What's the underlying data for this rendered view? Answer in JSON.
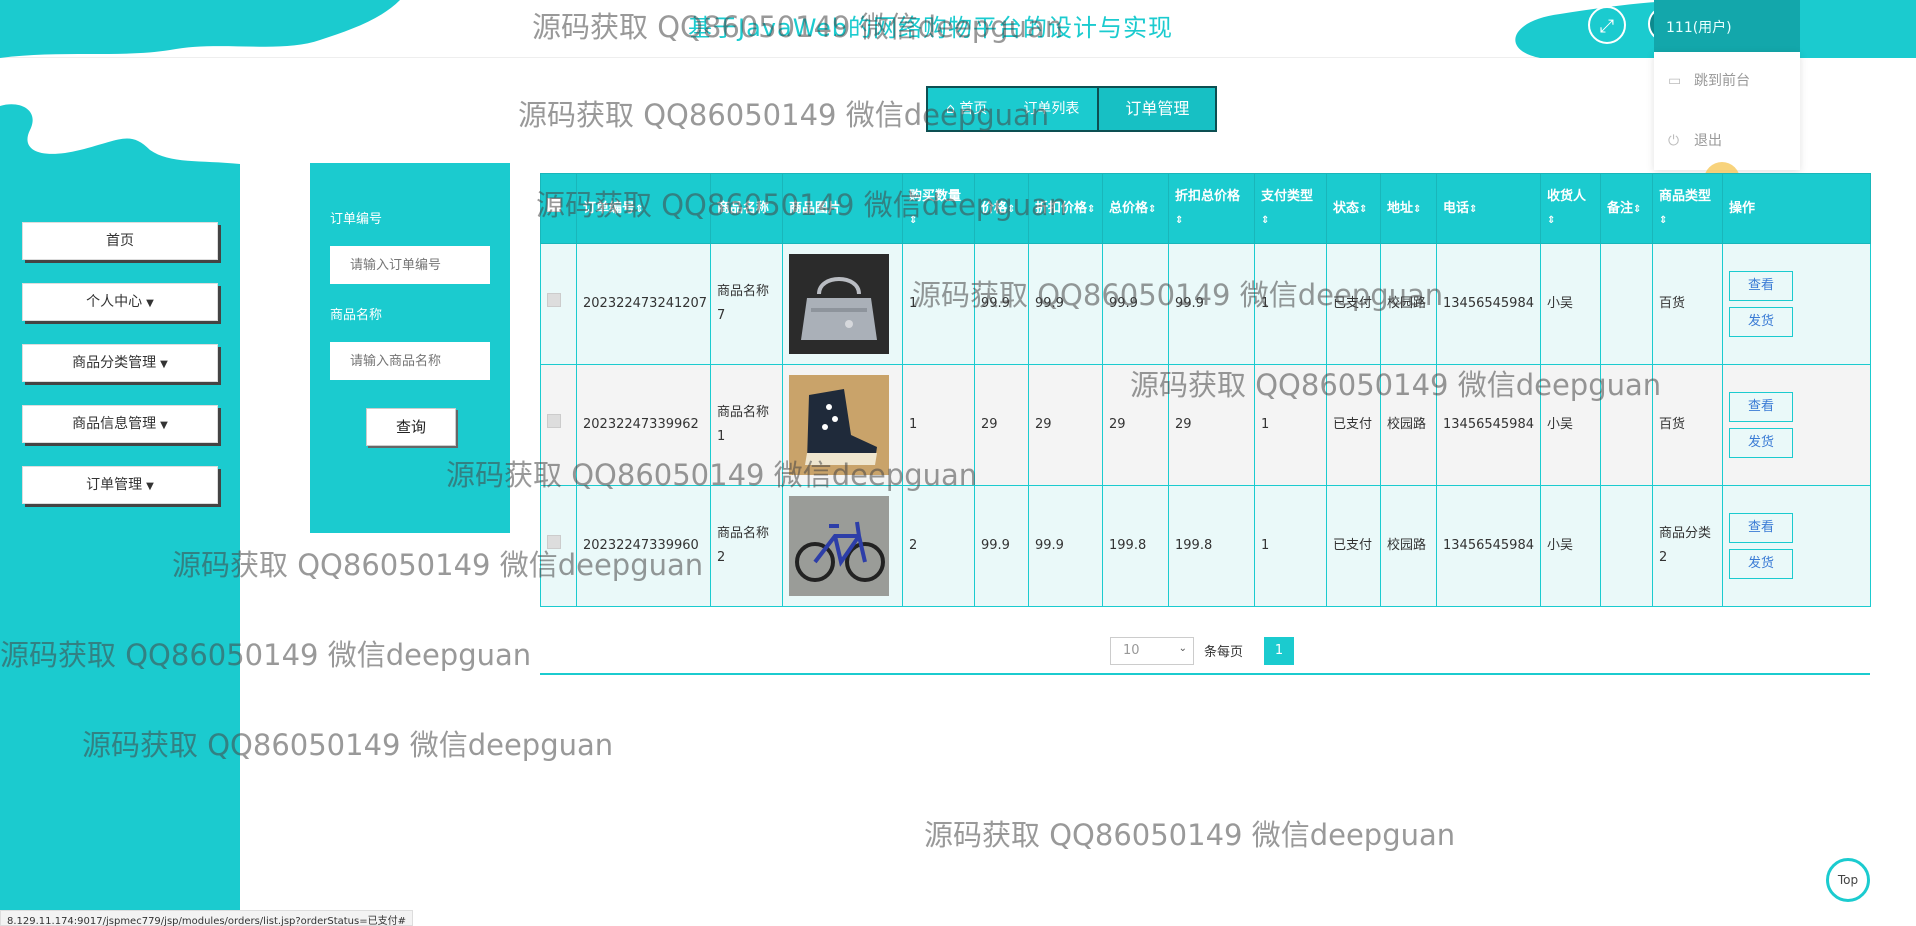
{
  "header": {
    "site_title": "基于JavaWeb的网络购物平台的设计与实现",
    "user_name": "111(用户)",
    "menu": [
      {
        "label": "跳到前台"
      },
      {
        "label": "退出"
      }
    ]
  },
  "breadcrumb": [
    "首页",
    "订单管理",
    "订单列表",
    "订单管理"
  ],
  "sidebar": {
    "items": [
      {
        "label": "首页"
      },
      {
        "label": "个人中心"
      },
      {
        "label": "商品分类管理"
      },
      {
        "label": "商品信息管理"
      },
      {
        "label": "订单管理"
      }
    ]
  },
  "search": {
    "order_no_label": "订单编号",
    "order_no_placeholder": "请输入订单编号",
    "product_name_label": "商品名称",
    "product_name_placeholder": "请输入商品名称",
    "query_button": "查询"
  },
  "table": {
    "headers": [
      "订单编号",
      "商品名称",
      "商品图片",
      "购买数量",
      "价格",
      "折扣价格",
      "总价格",
      "折扣总价格",
      "支付类型",
      "状态",
      "地址",
      "电话",
      "收货人",
      "备注",
      "商品类型",
      "操作"
    ],
    "rows": [
      {
        "order_no": "202322473241207",
        "name": "商品名称7",
        "image": "handbag",
        "qty": "1",
        "price": "99.9",
        "discount_price": "99.9",
        "total": "99.9",
        "discount_total": "99.9",
        "pay_type": "1",
        "status": "已支付",
        "address": "校园路",
        "phone": "13456545984",
        "receiver": "小吴",
        "remark": "",
        "type": "百货"
      },
      {
        "order_no": "20232247339962",
        "name": "商品名称1",
        "image": "sneaker",
        "qty": "1",
        "price": "29",
        "discount_price": "29",
        "total": "29",
        "discount_total": "29",
        "pay_type": "1",
        "status": "已支付",
        "address": "校园路",
        "phone": "13456545984",
        "receiver": "小吴",
        "remark": "",
        "type": "百货"
      },
      {
        "order_no": "20232247339960",
        "name": "商品名称2",
        "image": "bicycle",
        "qty": "2",
        "price": "99.9",
        "discount_price": "99.9",
        "total": "199.8",
        "discount_total": "199.8",
        "pay_type": "1",
        "status": "已支付",
        "address": "校园路",
        "phone": "13456545984",
        "receiver": "小吴",
        "remark": "",
        "type": "商品分类2"
      }
    ],
    "view_button": "查看",
    "ship_button": "发货"
  },
  "pager": {
    "page_size": "10",
    "per_page_label": "条每页",
    "current_page": "1"
  },
  "watermark": "源码获取 QQ86050149 微信deepguan",
  "top_button": "Top",
  "status_url": "8.129.11.174:9017/jspmec779/jsp/modules/orders/list.jsp?orderStatus=已支付#",
  "colors": {
    "accent": "#1bcbcf",
    "dark_accent": "#13a7ab"
  }
}
